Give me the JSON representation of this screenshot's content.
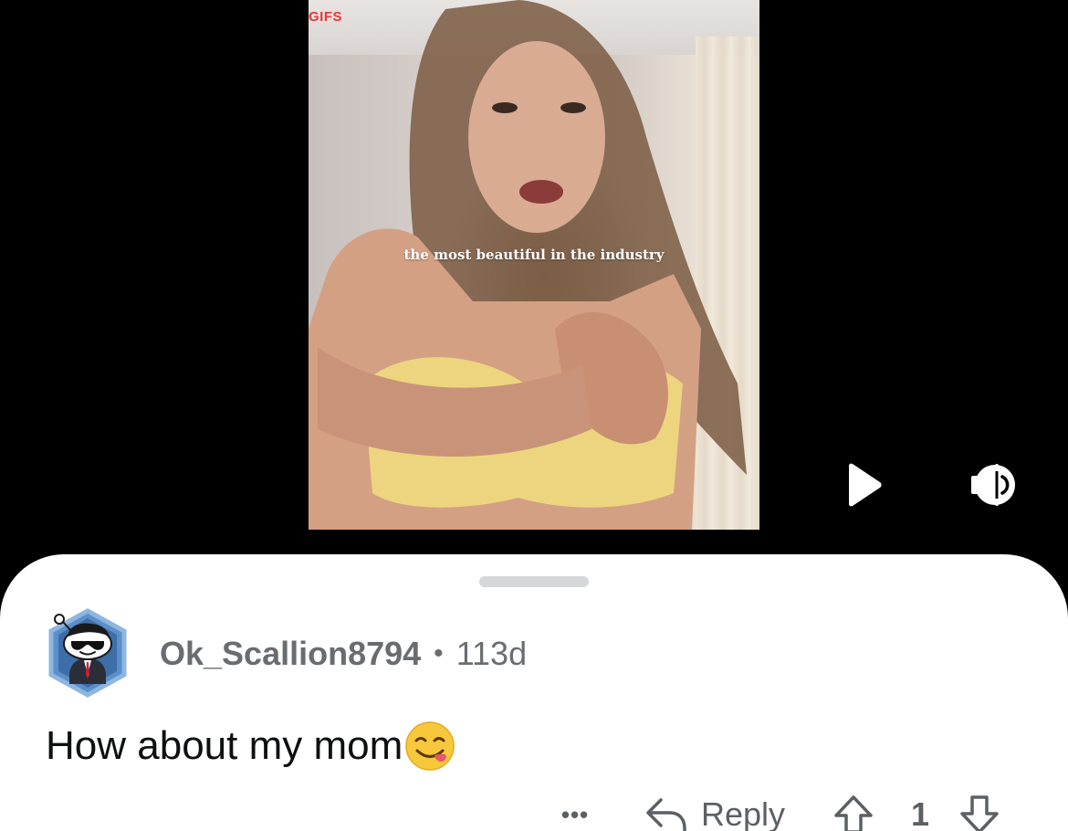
{
  "video": {
    "source_label": "GIFS",
    "caption": "the most beautiful in the industry",
    "controls": {
      "play_icon": "play-icon",
      "volume_icon": "volume-icon"
    }
  },
  "comment": {
    "username": "Ok_Scallion8794",
    "separator": "•",
    "age": "113d",
    "body": "How about my mom",
    "emoji": "yum-face-emoji",
    "actions": {
      "more": "•••",
      "reply": "Reply",
      "score": "1"
    }
  },
  "colors": {
    "background": "#000000",
    "sheet": "#ffffff",
    "meta_text": "#6a6d70",
    "body_text": "#0d0f10",
    "source_label": "#e23b3b",
    "avatar_ring": "#5a8fc7"
  }
}
